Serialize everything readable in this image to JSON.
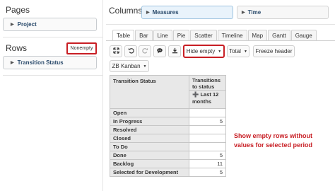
{
  "pages": {
    "title": "Pages",
    "items": [
      {
        "label": "Project"
      }
    ]
  },
  "rows": {
    "title": "Rows",
    "nonempty_label": "Nonempty",
    "items": [
      {
        "label": "Transition Status"
      }
    ]
  },
  "columns": {
    "title": "Columns",
    "items": [
      {
        "label": "Measures"
      },
      {
        "label": "Time"
      }
    ]
  },
  "tabs": [
    {
      "label": "Table",
      "active": true
    },
    {
      "label": "Bar"
    },
    {
      "label": "Line"
    },
    {
      "label": "Pie"
    },
    {
      "label": "Scatter"
    },
    {
      "label": "Timeline"
    },
    {
      "label": "Map"
    },
    {
      "label": "Gantt"
    },
    {
      "label": "Gauge"
    }
  ],
  "toolbar": {
    "hide_empty_label": "Hide empty",
    "total_label": "Total",
    "freeze_header_label": "Freeze header",
    "kanban_label": "ZB Kanban",
    "icons": [
      "expand-icon",
      "undo-icon",
      "redo-icon",
      "comment-icon",
      "download-icon"
    ]
  },
  "table": {
    "row_header": "Transition Status",
    "measure_header": "Transitions to status",
    "period_header": "Last 12 months",
    "rows": [
      {
        "label": "Open",
        "value": ""
      },
      {
        "label": "In Progress",
        "value": "5"
      },
      {
        "label": "Resolved",
        "value": ""
      },
      {
        "label": "Closed",
        "value": ""
      },
      {
        "label": "To Do",
        "value": ""
      },
      {
        "label": "Done",
        "value": "5"
      },
      {
        "label": "Backlog",
        "value": "11"
      },
      {
        "label": "Selected for Development",
        "value": "5"
      }
    ]
  },
  "annotation": {
    "line1": "Show empty rows without",
    "line2": "values for selected period"
  },
  "colors": {
    "highlight": "#c81e24",
    "pill_blue": "#e9f3fb",
    "header_gray": "#e8e8e8"
  }
}
